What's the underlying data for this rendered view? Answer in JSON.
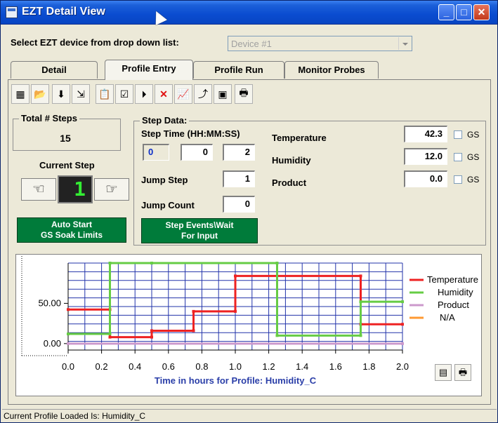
{
  "window": {
    "title": "EZT Detail View"
  },
  "device_select": {
    "label": "Select EZT device from drop down list:",
    "value": "Device #1"
  },
  "tabs": [
    {
      "label": "Detail"
    },
    {
      "label": "Profile Entry"
    },
    {
      "label": "Profile Run"
    },
    {
      "label": "Monitor Probes"
    }
  ],
  "toolbar": {
    "tools": [
      "calculator-icon",
      "folder-open-icon",
      "download-icon",
      "export-icon",
      "clipboard-icon",
      "checklist-icon",
      "play-step-icon",
      "delete-icon",
      "chart-icon",
      "upload-icon",
      "sd-card-icon",
      "print-icon"
    ]
  },
  "total_steps": {
    "title": "Total # Steps",
    "value": "15"
  },
  "current_step": {
    "title": "Current Step",
    "value": "1"
  },
  "auto_start_button": {
    "line1": "Auto Start",
    "line2": "GS Soak Limits"
  },
  "step_data": {
    "title": "Step Data:",
    "time_label": "Step Time (HH:MM:SS)",
    "hh": "0",
    "mm": "0",
    "ss": "2",
    "jump_step_label": "Jump Step",
    "jump_step": "1",
    "jump_count_label": "Jump Count",
    "jump_count": "0",
    "events_button": {
      "line1": "Step Events\\Wait",
      "line2": "For Input"
    },
    "temperature_label": "Temperature",
    "temperature": "42.3",
    "humidity_label": "Humidity",
    "humidity": "12.0",
    "product_label": "Product",
    "product": "0.0",
    "gs_label": "GS"
  },
  "chart_data": {
    "type": "line",
    "xlabel": "Time in hours for Profile: Humidity_C",
    "xlim": [
      0.0,
      2.0
    ],
    "ylim": [
      -8,
      100
    ],
    "xticks": [
      "0.0",
      "0.2",
      "0.4",
      "0.6",
      "0.8",
      "1.0",
      "1.2",
      "1.4",
      "1.6",
      "1.8",
      "2.0"
    ],
    "yticks": [
      {
        "v": 50,
        "label": "50.00"
      },
      {
        "v": 0,
        "label": "0.00"
      }
    ],
    "grid": true,
    "legend_position": "right",
    "series": [
      {
        "name": "Temperature",
        "color": "#ee2222",
        "x": [
          0.0,
          0.25,
          0.25,
          0.5,
          0.5,
          0.75,
          0.75,
          1.0,
          1.0,
          1.75,
          1.75,
          2.0
        ],
        "y": [
          42.3,
          42.3,
          8,
          8,
          16,
          16,
          40,
          40,
          84,
          84,
          24,
          24
        ]
      },
      {
        "name": "Humidity",
        "color": "#66cc44",
        "x": [
          0.0,
          0.25,
          0.25,
          0.5,
          0.5,
          1.25,
          1.25,
          1.75,
          1.75,
          2.0
        ],
        "y": [
          12,
          12,
          100,
          100,
          100,
          100,
          10,
          10,
          52,
          52
        ]
      },
      {
        "name": "Product",
        "color": "#cc99cc",
        "x": [
          0.0,
          2.0
        ],
        "y": [
          0,
          0
        ]
      },
      {
        "name": "N/A",
        "color": "#ff9933",
        "x": [],
        "y": []
      }
    ]
  },
  "status_bar": {
    "text": "Current Profile Loaded Is: Humidity_C"
  }
}
